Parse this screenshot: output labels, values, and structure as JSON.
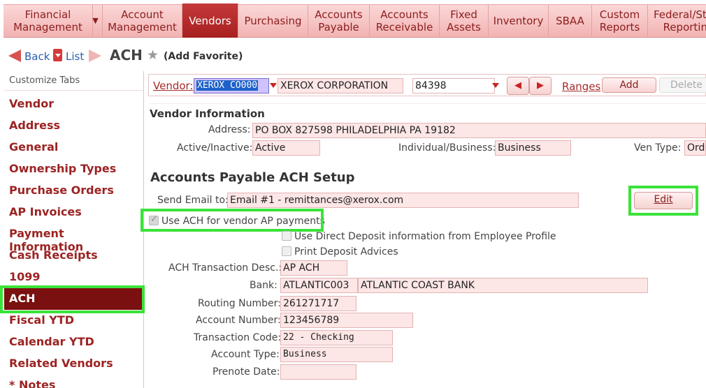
{
  "topnav": {
    "tabs": [
      {
        "label": "Financial Management",
        "active": false
      },
      {
        "label": "Account Management",
        "active": false
      },
      {
        "label": "Vendors",
        "active": true
      },
      {
        "label": "Purchasing",
        "active": false
      },
      {
        "label": "Accounts Payable",
        "active": false
      },
      {
        "label": "Accounts Receivable",
        "active": false
      },
      {
        "label": "Fixed Assets",
        "active": false
      },
      {
        "label": "Inventory",
        "active": false
      },
      {
        "label": "SBAA",
        "active": false
      },
      {
        "label": "Custom Reports",
        "active": false
      },
      {
        "label": "Federal/State Reporting",
        "active": false
      }
    ],
    "colors": {
      "bar": "#f2b3b3",
      "active": "#b02626"
    }
  },
  "titlebar": {
    "back_label": "Back",
    "list_label": "List",
    "page_title": "ACH",
    "favorite_label": "(Add Favorite)"
  },
  "sidebar": {
    "header": "Customize Tabs",
    "items": [
      {
        "label": "Vendor"
      },
      {
        "label": "Address"
      },
      {
        "label": "General"
      },
      {
        "label": "Ownership Types"
      },
      {
        "label": "Purchase Orders"
      },
      {
        "label": "AP Invoices"
      },
      {
        "label": "Payment Information"
      },
      {
        "label": "Cash Receipts"
      },
      {
        "label": "1099"
      },
      {
        "label": "ACH",
        "active": true
      },
      {
        "label": "Fiscal YTD"
      },
      {
        "label": "Calendar YTD"
      },
      {
        "label": "Related Vendors"
      },
      {
        "label": "* Notes"
      }
    ]
  },
  "vendorbar": {
    "vendor_label": "Vendor:",
    "vendor_code": "XEROX CO000",
    "vendor_name": "XEROX CORPORATION",
    "vendor_number": "84398",
    "ranges_label": "Ranges",
    "add_label": "Add",
    "delete_label": "Delete"
  },
  "vendor_info": {
    "title": "Vendor Information",
    "address_label": "Address:",
    "address": "PO BOX 827598 PHILADELPHIA PA 19182",
    "active_label": "Active/Inactive:",
    "active": "Active",
    "individual_label": "Individual/Business:",
    "individual": "Business",
    "ventype_label": "Ven Type:",
    "ventype": "Orde"
  },
  "ach": {
    "title": "Accounts Payable ACH Setup",
    "send_email_label": "Send Email to:",
    "send_email": "Email #1 - remittances@xerox.com",
    "edit_label": "Edit",
    "use_ach_label": "Use ACH for vendor AP payments",
    "use_ach_checked": true,
    "direct_deposit_label": "Use Direct Deposit information from Employee Profile",
    "direct_deposit_checked": false,
    "print_advices_label": "Print Deposit Advices",
    "print_advices_checked": false,
    "trans_desc_label": "ACH Transaction Desc.:",
    "trans_desc": "AP ACH",
    "bank_label": "Bank:",
    "bank_code": "ATLANTIC003",
    "bank_name": "ATLANTIC COAST BANK",
    "routing_label": "Routing Number:",
    "routing": "261271717",
    "account_label": "Account Number:",
    "account": "123456789",
    "trans_code_label": "Transaction Code:",
    "trans_code": "22 - Checking",
    "account_type_label": "Account Type:",
    "account_type": "Business",
    "prenote_label": "Prenote Date:",
    "prenote": ""
  }
}
